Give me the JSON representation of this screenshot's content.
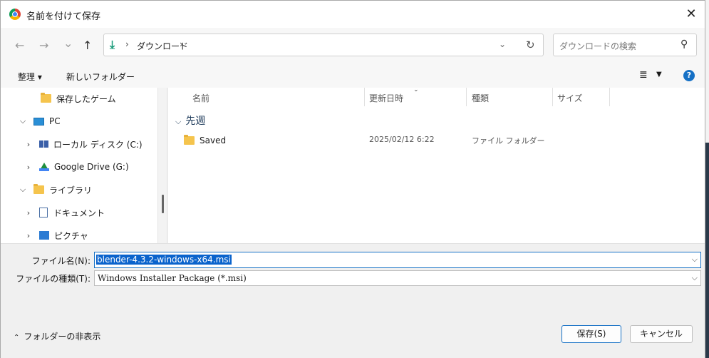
{
  "window": {
    "title": "名前を付けて保存",
    "close": "✕"
  },
  "navigation": {
    "back": "←",
    "forward": "→",
    "recent": "⌄",
    "up": "↑",
    "address": {
      "separator": "›",
      "folder": "ダウンロード",
      "dropdown": "⌄",
      "refresh": "↻"
    },
    "search": {
      "placeholder": "ダウンロードの検索"
    }
  },
  "commandbar": {
    "organize": "整理 ▾",
    "new_folder": "新しいフォルダー",
    "view_icon": "≣",
    "view_arrow": "▼",
    "help": "?"
  },
  "sidebar": {
    "items": [
      {
        "label": "保存したゲーム",
        "icon": "folder-icon"
      },
      {
        "label": "PC",
        "icon": "pc-icon",
        "expanded": true
      },
      {
        "label": "ローカル ディスク (C:)",
        "icon": "disk-icon"
      },
      {
        "label": "Google Drive (G:)",
        "icon": "google-drive-icon"
      },
      {
        "label": "ライブラリ",
        "icon": "folder-icon",
        "expanded": true
      },
      {
        "label": "ドキュメント",
        "icon": "document-icon"
      },
      {
        "label": "ピクチャ",
        "icon": "picture-icon"
      }
    ]
  },
  "file_list": {
    "columns": [
      "名前",
      "更新日時",
      "種類",
      "サイズ"
    ],
    "groups": [
      {
        "label": "先週",
        "files": [
          {
            "name": "Saved",
            "modified": "2025/02/12 6:22",
            "type": "ファイル フォルダー",
            "size": ""
          }
        ]
      }
    ]
  },
  "form": {
    "filename_label": "ファイル名(N):",
    "filename_value": "blender-4.3.2-windows-x64.msi",
    "filetype_label": "ファイルの種類(T):",
    "filetype_value": "Windows Installer Package (*.msi)"
  },
  "footer": {
    "hide_folders": "フォルダーの非表示",
    "save_button": "保存(S)",
    "cancel_button": "キャンセル"
  },
  "colors": {
    "accent": "#1570c5",
    "selection": "#0a63cc",
    "folder": "#f5c44d"
  }
}
